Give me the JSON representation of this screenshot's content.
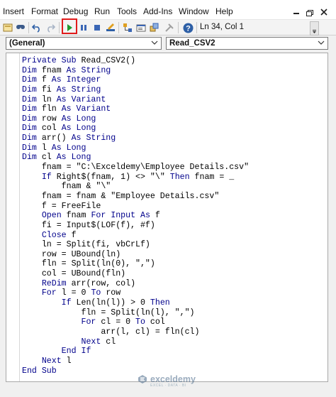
{
  "menu": {
    "items": [
      "Insert",
      "Format",
      "Debug",
      "Run",
      "Tools",
      "Add-Ins",
      "Window",
      "Help"
    ],
    "window_controls": [
      "minimize-icon",
      "restore-icon",
      "close-icon"
    ]
  },
  "toolbar": {
    "cursor_position": "Ln 34, Col 1",
    "highlight_color": "#e01b1b"
  },
  "dropdowns": {
    "object": "(General)",
    "procedure": "Read_CSV2"
  },
  "code": {
    "lines": [
      [
        [
          "kw",
          "Private Sub "
        ],
        [
          "",
          "Read_CSV2()"
        ]
      ],
      [
        [
          "kw",
          "Dim "
        ],
        [
          "",
          "fnam "
        ],
        [
          "kw",
          "As String"
        ]
      ],
      [
        [
          "kw",
          "Dim "
        ],
        [
          "",
          "f "
        ],
        [
          "kw",
          "As Integer"
        ]
      ],
      [
        [
          "kw",
          "Dim "
        ],
        [
          "",
          "fi "
        ],
        [
          "kw",
          "As String"
        ]
      ],
      [
        [
          "kw",
          "Dim "
        ],
        [
          "",
          "ln "
        ],
        [
          "kw",
          "As Variant"
        ]
      ],
      [
        [
          "kw",
          "Dim "
        ],
        [
          "",
          "fln "
        ],
        [
          "kw",
          "As Variant"
        ]
      ],
      [
        [
          "kw",
          "Dim "
        ],
        [
          "",
          "row "
        ],
        [
          "kw",
          "As Long"
        ]
      ],
      [
        [
          "kw",
          "Dim "
        ],
        [
          "",
          "col "
        ],
        [
          "kw",
          "As Long"
        ]
      ],
      [
        [
          "kw",
          "Dim "
        ],
        [
          "",
          "arr() "
        ],
        [
          "kw",
          "As String"
        ]
      ],
      [
        [
          "kw",
          "Dim "
        ],
        [
          "",
          "l "
        ],
        [
          "kw",
          "As Long"
        ]
      ],
      [
        [
          "kw",
          "Dim "
        ],
        [
          "",
          "cl "
        ],
        [
          "kw",
          "As Long"
        ]
      ],
      [
        [
          "",
          "    fnam = \"C:\\Exceldemy\\Employee Details.csv\""
        ]
      ],
      [
        [
          "",
          "    "
        ],
        [
          "kw",
          "If "
        ],
        [
          "",
          "Right$(fnam, 1) <> \"\\\" "
        ],
        [
          "kw",
          "Then "
        ],
        [
          "",
          "fnam = _"
        ]
      ],
      [
        [
          "",
          "        fnam & \"\\\""
        ]
      ],
      [
        [
          "",
          "    fnam = fnam & \"Employee Details.csv\""
        ]
      ],
      [
        [
          "",
          "    f = FreeFile"
        ]
      ],
      [
        [
          "",
          "    "
        ],
        [
          "kw",
          "Open "
        ],
        [
          "",
          "fnam "
        ],
        [
          "kw",
          "For Input As "
        ],
        [
          "",
          "f"
        ]
      ],
      [
        [
          "",
          "    fi = Input$(LOF(f), #f)"
        ]
      ],
      [
        [
          "",
          "    "
        ],
        [
          "kw",
          "Close "
        ],
        [
          "",
          "f"
        ]
      ],
      [
        [
          "",
          "    ln = Split(fi, vbCrLf)"
        ]
      ],
      [
        [
          "",
          "    row = UBound(ln)"
        ]
      ],
      [
        [
          "",
          "    fln = Split(ln(0), \",\")"
        ]
      ],
      [
        [
          "",
          "    col = UBound(fln)"
        ]
      ],
      [
        [
          "",
          "    "
        ],
        [
          "kw",
          "ReDim "
        ],
        [
          "",
          "arr(row, col)"
        ]
      ],
      [
        [
          "",
          "    "
        ],
        [
          "kw",
          "For "
        ],
        [
          "",
          "l = 0 "
        ],
        [
          "kw",
          "To "
        ],
        [
          "",
          "row"
        ]
      ],
      [
        [
          "",
          "        "
        ],
        [
          "kw",
          "If "
        ],
        [
          "",
          "Len(ln(l)) > 0 "
        ],
        [
          "kw",
          "Then"
        ]
      ],
      [
        [
          "",
          "            fln = Split(ln(l), \",\")"
        ]
      ],
      [
        [
          "",
          "            "
        ],
        [
          "kw",
          "For "
        ],
        [
          "",
          "cl = 0 "
        ],
        [
          "kw",
          "To "
        ],
        [
          "",
          "col"
        ]
      ],
      [
        [
          "",
          "                arr(l, cl) = fln(cl)"
        ]
      ],
      [
        [
          "",
          "            "
        ],
        [
          "kw",
          "Next "
        ],
        [
          "",
          "cl"
        ]
      ],
      [
        [
          "",
          "        "
        ],
        [
          "kw",
          "End If"
        ]
      ],
      [
        [
          "",
          "    "
        ],
        [
          "kw",
          "Next "
        ],
        [
          "",
          "l"
        ]
      ],
      [
        [
          "kw",
          "End Sub"
        ]
      ]
    ]
  },
  "watermark": {
    "name": "exceldemy",
    "tagline": "EXCEL · DATA · BI"
  }
}
